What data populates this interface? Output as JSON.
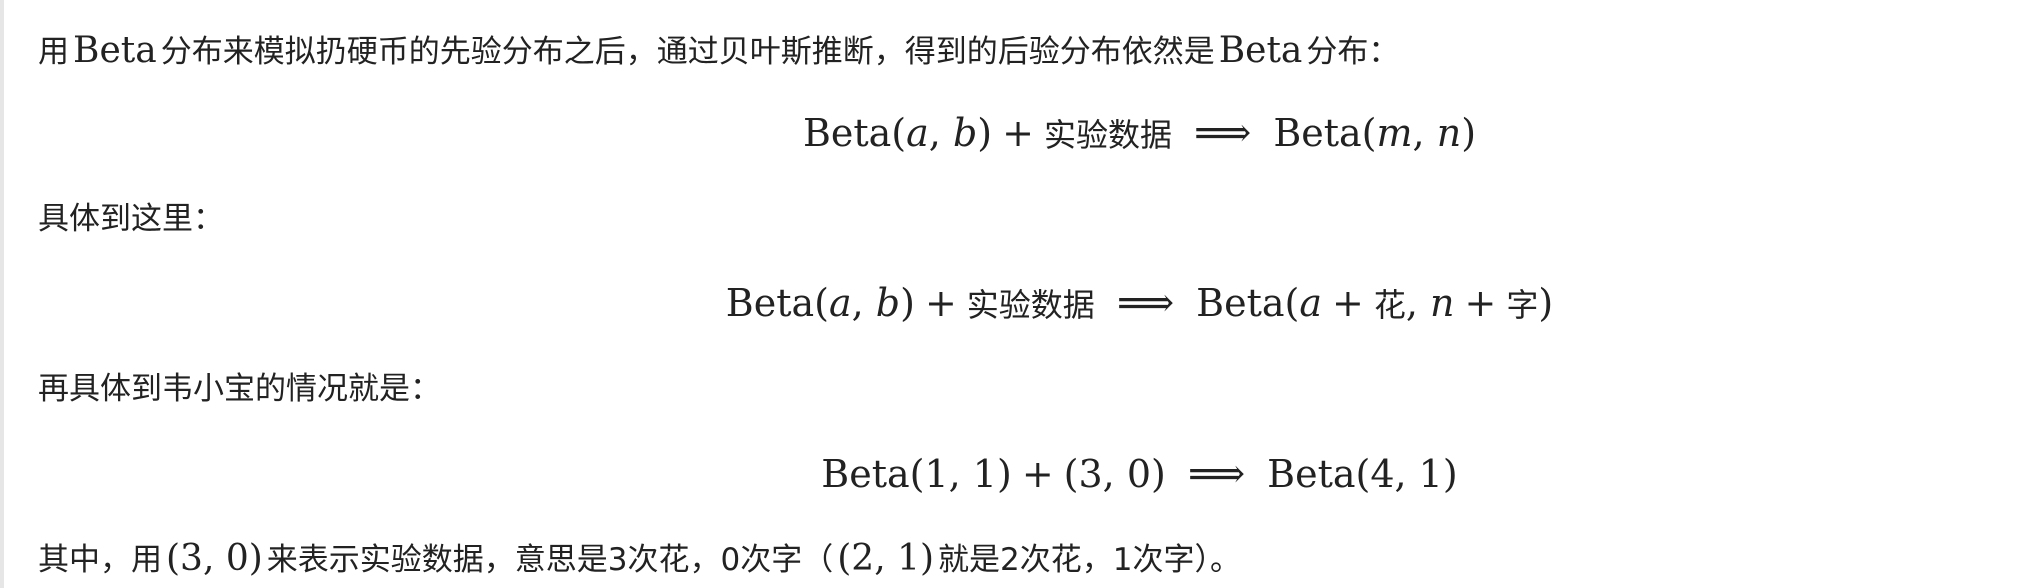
{
  "paragraphs": {
    "p1": {
      "prefix": "用",
      "beta1": "Beta",
      "middle": "分布来模拟扔硬币的先验分布之后，通过贝叶斯推断，得到的后验分布依然是",
      "beta2": "Beta",
      "suffix": "分布："
    },
    "p2": "具体到这里：",
    "p3": "再具体到韦小宝的情况就是：",
    "p4": {
      "prefix": "其中，用",
      "math1": "(3, 0)",
      "middle": "来表示实验数据，意思是3次花，0次字（",
      "math2": "(2, 1)",
      "suffix": "就是2次花，1次字）。"
    }
  },
  "equations": {
    "eq1": {
      "lhs_beta": "Beta(",
      "lhs_a": "a",
      "lhs_comma": ", ",
      "lhs_b": "b",
      "lhs_close": ")",
      "plus": "+",
      "data_label": "实验数据",
      "arrow": "⟹",
      "rhs_beta": "Beta(",
      "rhs_m": "m",
      "rhs_comma": ", ",
      "rhs_n": "n",
      "rhs_close": ")"
    },
    "eq2": {
      "lhs_beta": "Beta(",
      "lhs_a": "a",
      "lhs_comma": ", ",
      "lhs_b": "b",
      "lhs_close": ")",
      "plus": "+",
      "data_label": "实验数据",
      "arrow": "⟹",
      "rhs_beta": "Beta(",
      "rhs_a": "a",
      "rhs_plus1": "+",
      "rhs_hua": "花",
      "rhs_comma": ", ",
      "rhs_n": "n",
      "rhs_plus2": "+",
      "rhs_zi": "字",
      "rhs_close": ")"
    },
    "eq3": {
      "lhs": "Beta(1, 1)",
      "plus": "+",
      "data": "(3, 0)",
      "arrow": "⟹",
      "rhs": "Beta(4, 1)"
    }
  }
}
